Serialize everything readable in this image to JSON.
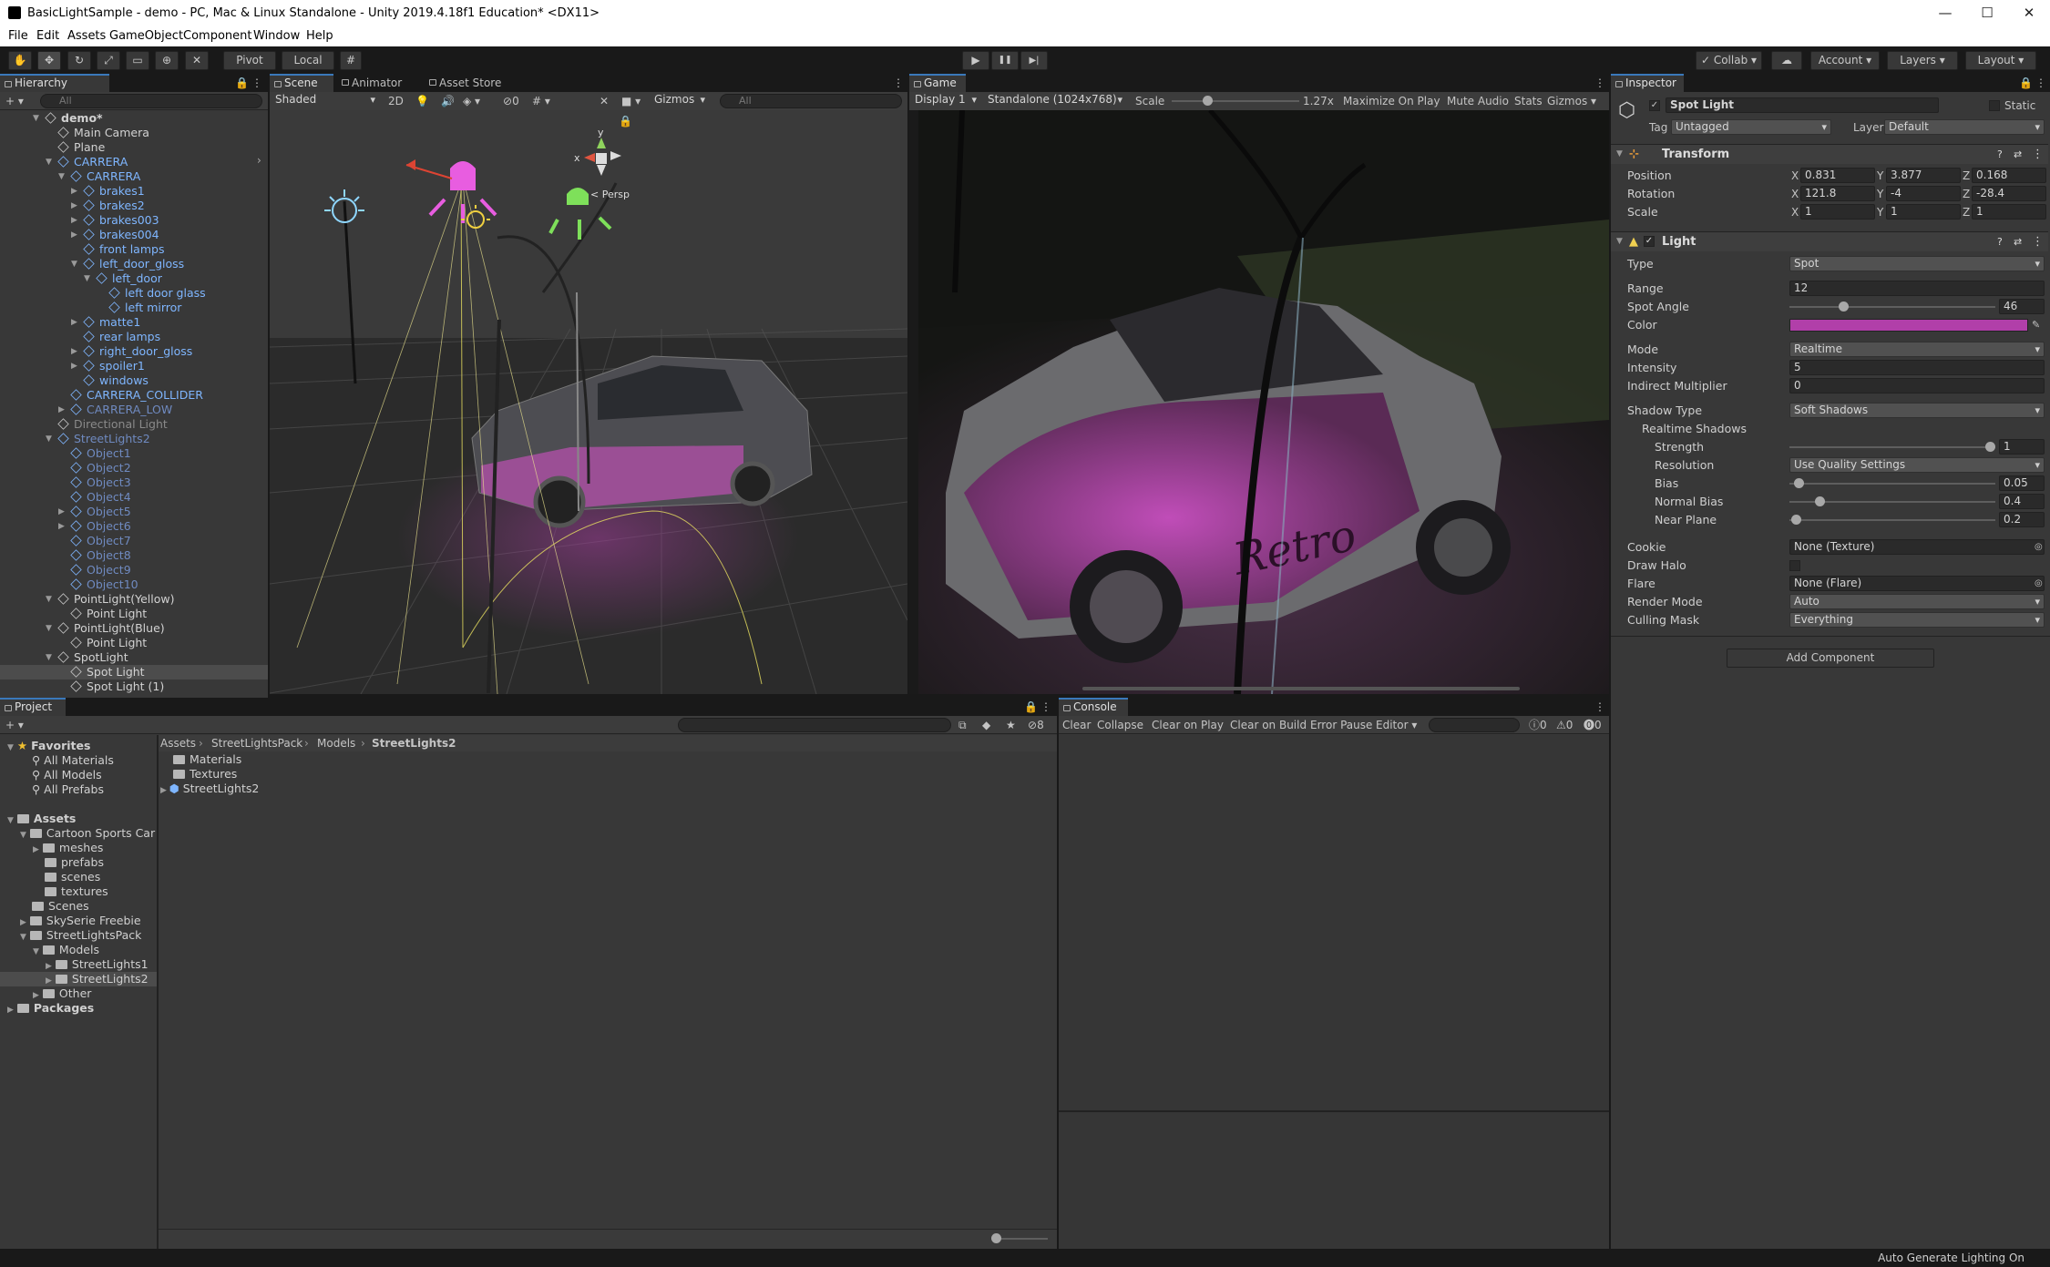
{
  "window": {
    "title": "BasicLightSample - demo - PC, Mac & Linux Standalone - Unity 2019.4.18f1 Education* <DX11>",
    "min": "—",
    "max": "☐",
    "close": "✕"
  },
  "menu": [
    "File",
    "Edit",
    "Assets",
    "GameObject",
    "Component",
    "Window",
    "Help"
  ],
  "toolbar": {
    "pivot": "Pivot",
    "local": "Local",
    "collab": "Collab",
    "account": "Account",
    "layers": "Layers",
    "layout": "Layout",
    "play": "▶",
    "pause": "❚❚",
    "step": "▶|"
  },
  "hierarchy": {
    "tab": "Hierarchy",
    "search": "All",
    "rows": [
      {
        "label": "demo*",
        "indent": 0,
        "cls": "",
        "arrow": "▼",
        "bold": true
      },
      {
        "label": "Main Camera",
        "indent": 1,
        "cls": "",
        "arrow": ""
      },
      {
        "label": "Plane",
        "indent": 1,
        "cls": "",
        "arrow": ""
      },
      {
        "label": "CARRERA",
        "indent": 1,
        "cls": "blue",
        "arrow": "▼"
      },
      {
        "label": "CARRERA",
        "indent": 2,
        "cls": "blue",
        "arrow": "▼"
      },
      {
        "label": "brakes1",
        "indent": 3,
        "cls": "blue",
        "arrow": "▶"
      },
      {
        "label": "brakes2",
        "indent": 3,
        "cls": "blue",
        "arrow": "▶"
      },
      {
        "label": "brakes003",
        "indent": 3,
        "cls": "blue",
        "arrow": "▶"
      },
      {
        "label": "brakes004",
        "indent": 3,
        "cls": "blue",
        "arrow": "▶"
      },
      {
        "label": "front lamps",
        "indent": 3,
        "cls": "blue",
        "arrow": ""
      },
      {
        "label": "left_door_gloss",
        "indent": 3,
        "cls": "blue",
        "arrow": "▼"
      },
      {
        "label": "left_door",
        "indent": 4,
        "cls": "blue",
        "arrow": "▼"
      },
      {
        "label": "left door glass",
        "indent": 5,
        "cls": "blue",
        "arrow": ""
      },
      {
        "label": "left mirror",
        "indent": 5,
        "cls": "blue",
        "arrow": ""
      },
      {
        "label": "matte1",
        "indent": 3,
        "cls": "blue",
        "arrow": "▶"
      },
      {
        "label": "rear lamps",
        "indent": 3,
        "cls": "blue",
        "arrow": ""
      },
      {
        "label": "right_door_gloss",
        "indent": 3,
        "cls": "blue",
        "arrow": "▶"
      },
      {
        "label": "spoiler1",
        "indent": 3,
        "cls": "blue",
        "arrow": "▶"
      },
      {
        "label": "windows",
        "indent": 3,
        "cls": "blue",
        "arrow": ""
      },
      {
        "label": "CARRERA_COLLIDER",
        "indent": 2,
        "cls": "blue",
        "arrow": ""
      },
      {
        "label": "CARRERA_LOW",
        "indent": 2,
        "cls": "dim",
        "arrow": "▶"
      },
      {
        "label": "Directional Light",
        "indent": 1,
        "cls": "gray",
        "arrow": ""
      },
      {
        "label": "StreetLights2",
        "indent": 1,
        "cls": "dim",
        "arrow": "▼"
      },
      {
        "label": "Object1",
        "indent": 2,
        "cls": "dim",
        "arrow": ""
      },
      {
        "label": "Object2",
        "indent": 2,
        "cls": "dim",
        "arrow": ""
      },
      {
        "label": "Object3",
        "indent": 2,
        "cls": "dim",
        "arrow": ""
      },
      {
        "label": "Object4",
        "indent": 2,
        "cls": "dim",
        "arrow": ""
      },
      {
        "label": "Object5",
        "indent": 2,
        "cls": "dim",
        "arrow": "▶"
      },
      {
        "label": "Object6",
        "indent": 2,
        "cls": "dim",
        "arrow": "▶"
      },
      {
        "label": "Object7",
        "indent": 2,
        "cls": "dim",
        "arrow": ""
      },
      {
        "label": "Object8",
        "indent": 2,
        "cls": "dim",
        "arrow": ""
      },
      {
        "label": "Object9",
        "indent": 2,
        "cls": "dim",
        "arrow": ""
      },
      {
        "label": "Object10",
        "indent": 2,
        "cls": "dim",
        "arrow": ""
      },
      {
        "label": "PointLight(Yellow)",
        "indent": 1,
        "cls": "",
        "arrow": "▼"
      },
      {
        "label": "Point Light",
        "indent": 2,
        "cls": "",
        "arrow": ""
      },
      {
        "label": "PointLight(Blue)",
        "indent": 1,
        "cls": "",
        "arrow": "▼"
      },
      {
        "label": "Point Light",
        "indent": 2,
        "cls": "",
        "arrow": ""
      },
      {
        "label": "SpotLight",
        "indent": 1,
        "cls": "",
        "arrow": "▼"
      },
      {
        "label": "Spot Light",
        "indent": 2,
        "cls": "",
        "arrow": "",
        "selected": true
      },
      {
        "label": "Spot Light (1)",
        "indent": 2,
        "cls": "",
        "arrow": ""
      }
    ]
  },
  "scene": {
    "tab": "Scene",
    "animator": "Animator",
    "asset_store": "Asset Store",
    "shading": "Shaded",
    "mode2d": "2D",
    "hidden_count": "0",
    "gizmos": "Gizmos",
    "search": "All",
    "persp": "< Persp",
    "axis_x": "x",
    "axis_y": "y"
  },
  "game": {
    "tab": "Game",
    "display": "Display 1",
    "resolution": "Standalone (1024x768)",
    "scale_label": "Scale",
    "scale_value": "1.27x",
    "maximize": "Maximize On Play",
    "mute": "Mute Audio",
    "stats": "Stats",
    "gizmos": "Gizmos"
  },
  "inspector": {
    "tab": "Inspector",
    "object_name": "Spot Light",
    "static": "Static",
    "tag_label": "Tag",
    "tag": "Untagged",
    "layer_label": "Layer",
    "layer": "Default",
    "transform": {
      "title": "Transform",
      "rows": [
        {
          "label": "Position",
          "x": "0.831",
          "y": "3.877",
          "z": "0.168"
        },
        {
          "label": "Rotation",
          "x": "121.8",
          "y": "-4",
          "z": "-28.4"
        },
        {
          "label": "Scale",
          "x": "1",
          "y": "1",
          "z": "1"
        }
      ]
    },
    "light": {
      "title": "Light",
      "type_label": "Type",
      "type": "Spot",
      "range_label": "Range",
      "range": "12",
      "angle_label": "Spot Angle",
      "angle": "46",
      "angle_frac": 0.25,
      "color_label": "Color",
      "color": "#b13fa9",
      "mode_label": "Mode",
      "mode": "Realtime",
      "intensity_label": "Intensity",
      "intensity": "5",
      "indirect_label": "Indirect Multiplier",
      "indirect": "0",
      "shadow_label": "Shadow Type",
      "shadow": "Soft Shadows",
      "realtime_label": "Realtime Shadows",
      "strength_label": "Strength",
      "strength": "1",
      "strength_frac": 1.0,
      "resolution_label": "Resolution",
      "resolution": "Use Quality Settings",
      "bias_label": "Bias",
      "bias": "0.05",
      "bias_frac": 0.025,
      "normal_bias_label": "Normal Bias",
      "normal_bias": "0.4",
      "normal_bias_frac": 0.13,
      "near_label": "Near Plane",
      "near": "0.2",
      "near_frac": 0.01,
      "cookie_label": "Cookie",
      "cookie": "None (Texture)",
      "halo_label": "Draw Halo",
      "flare_label": "Flare",
      "flare": "None (Flare)",
      "render_label": "Render Mode",
      "render": "Auto",
      "culling_label": "Culling Mask",
      "culling": "Everything"
    },
    "add_component": "Add Component"
  },
  "project": {
    "tab": "Project",
    "hidden_count": "8",
    "breadcrumb": [
      "Assets",
      "StreetLightsPack",
      "Models",
      "StreetLights2"
    ],
    "tree": [
      {
        "label": "Favorites",
        "indent": 0,
        "type": "star",
        "arrow": "▼",
        "bold": true
      },
      {
        "label": "All Materials",
        "indent": 1,
        "type": "search",
        "arrow": ""
      },
      {
        "label": "All Models",
        "indent": 1,
        "type": "search",
        "arrow": ""
      },
      {
        "label": "All Prefabs",
        "indent": 1,
        "type": "search",
        "arrow": ""
      },
      {
        "label": "",
        "indent": 0,
        "type": "blank",
        "arrow": ""
      },
      {
        "label": "Assets",
        "indent": 0,
        "type": "folder",
        "arrow": "▼",
        "bold": true
      },
      {
        "label": "Cartoon Sports Car",
        "indent": 1,
        "type": "folder",
        "arrow": "▼"
      },
      {
        "label": "meshes",
        "indent": 2,
        "type": "folder",
        "arrow": "▶"
      },
      {
        "label": "prefabs",
        "indent": 2,
        "type": "folder",
        "arrow": ""
      },
      {
        "label": "scenes",
        "indent": 2,
        "type": "folder",
        "arrow": ""
      },
      {
        "label": "textures",
        "indent": 2,
        "type": "folder",
        "arrow": ""
      },
      {
        "label": "Scenes",
        "indent": 1,
        "type": "folder",
        "arrow": ""
      },
      {
        "label": "SkySerie Freebie",
        "indent": 1,
        "type": "folder",
        "arrow": "▶"
      },
      {
        "label": "StreetLightsPack",
        "indent": 1,
        "type": "folder",
        "arrow": "▼"
      },
      {
        "label": "Models",
        "indent": 2,
        "type": "folder",
        "arrow": "▼"
      },
      {
        "label": "StreetLights1",
        "indent": 3,
        "type": "folder",
        "arrow": "▶"
      },
      {
        "label": "StreetLights2",
        "indent": 3,
        "type": "folder",
        "arrow": "▶",
        "selected": true
      },
      {
        "label": "Other",
        "indent": 2,
        "type": "folder",
        "arrow": "▶"
      },
      {
        "label": "Packages",
        "indent": 0,
        "type": "folder",
        "arrow": "▶",
        "bold": true
      }
    ],
    "items": [
      {
        "label": "Materials",
        "type": "folder"
      },
      {
        "label": "Textures",
        "type": "folder"
      },
      {
        "label": "StreetLights2",
        "type": "model"
      }
    ]
  },
  "console": {
    "tab": "Console",
    "buttons": [
      "Clear",
      "Collapse",
      "Clear on Play",
      "Clear on Build",
      "Error Pause",
      "Editor"
    ],
    "logs": "0",
    "warnings": "0",
    "errors": "0"
  },
  "status": {
    "text": "Auto Generate Lighting On"
  }
}
